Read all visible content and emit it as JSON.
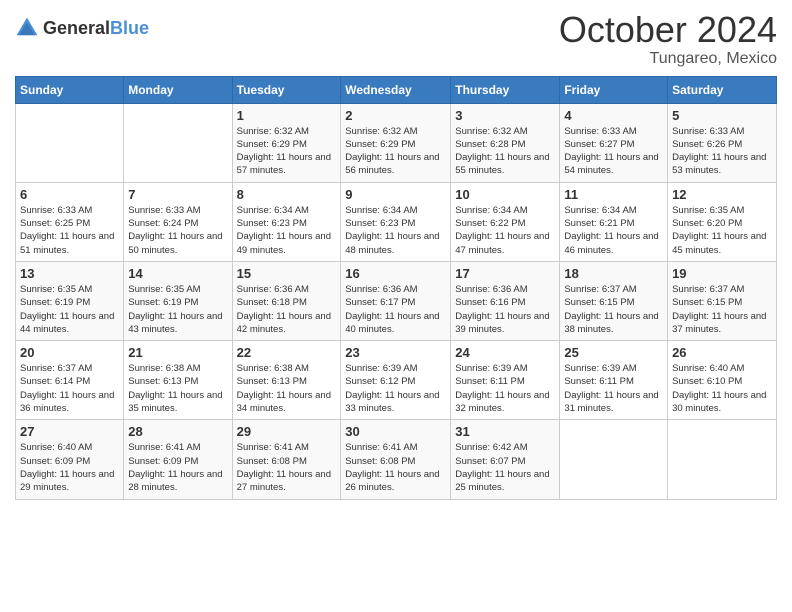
{
  "header": {
    "logo_general": "General",
    "logo_blue": "Blue",
    "month": "October 2024",
    "location": "Tungareo, Mexico"
  },
  "weekdays": [
    "Sunday",
    "Monday",
    "Tuesday",
    "Wednesday",
    "Thursday",
    "Friday",
    "Saturday"
  ],
  "weeks": [
    [
      {
        "day": "",
        "detail": ""
      },
      {
        "day": "",
        "detail": ""
      },
      {
        "day": "1",
        "detail": "Sunrise: 6:32 AM\nSunset: 6:29 PM\nDaylight: 11 hours and 57 minutes."
      },
      {
        "day": "2",
        "detail": "Sunrise: 6:32 AM\nSunset: 6:29 PM\nDaylight: 11 hours and 56 minutes."
      },
      {
        "day": "3",
        "detail": "Sunrise: 6:32 AM\nSunset: 6:28 PM\nDaylight: 11 hours and 55 minutes."
      },
      {
        "day": "4",
        "detail": "Sunrise: 6:33 AM\nSunset: 6:27 PM\nDaylight: 11 hours and 54 minutes."
      },
      {
        "day": "5",
        "detail": "Sunrise: 6:33 AM\nSunset: 6:26 PM\nDaylight: 11 hours and 53 minutes."
      }
    ],
    [
      {
        "day": "6",
        "detail": "Sunrise: 6:33 AM\nSunset: 6:25 PM\nDaylight: 11 hours and 51 minutes."
      },
      {
        "day": "7",
        "detail": "Sunrise: 6:33 AM\nSunset: 6:24 PM\nDaylight: 11 hours and 50 minutes."
      },
      {
        "day": "8",
        "detail": "Sunrise: 6:34 AM\nSunset: 6:23 PM\nDaylight: 11 hours and 49 minutes."
      },
      {
        "day": "9",
        "detail": "Sunrise: 6:34 AM\nSunset: 6:23 PM\nDaylight: 11 hours and 48 minutes."
      },
      {
        "day": "10",
        "detail": "Sunrise: 6:34 AM\nSunset: 6:22 PM\nDaylight: 11 hours and 47 minutes."
      },
      {
        "day": "11",
        "detail": "Sunrise: 6:34 AM\nSunset: 6:21 PM\nDaylight: 11 hours and 46 minutes."
      },
      {
        "day": "12",
        "detail": "Sunrise: 6:35 AM\nSunset: 6:20 PM\nDaylight: 11 hours and 45 minutes."
      }
    ],
    [
      {
        "day": "13",
        "detail": "Sunrise: 6:35 AM\nSunset: 6:19 PM\nDaylight: 11 hours and 44 minutes."
      },
      {
        "day": "14",
        "detail": "Sunrise: 6:35 AM\nSunset: 6:19 PM\nDaylight: 11 hours and 43 minutes."
      },
      {
        "day": "15",
        "detail": "Sunrise: 6:36 AM\nSunset: 6:18 PM\nDaylight: 11 hours and 42 minutes."
      },
      {
        "day": "16",
        "detail": "Sunrise: 6:36 AM\nSunset: 6:17 PM\nDaylight: 11 hours and 40 minutes."
      },
      {
        "day": "17",
        "detail": "Sunrise: 6:36 AM\nSunset: 6:16 PM\nDaylight: 11 hours and 39 minutes."
      },
      {
        "day": "18",
        "detail": "Sunrise: 6:37 AM\nSunset: 6:15 PM\nDaylight: 11 hours and 38 minutes."
      },
      {
        "day": "19",
        "detail": "Sunrise: 6:37 AM\nSunset: 6:15 PM\nDaylight: 11 hours and 37 minutes."
      }
    ],
    [
      {
        "day": "20",
        "detail": "Sunrise: 6:37 AM\nSunset: 6:14 PM\nDaylight: 11 hours and 36 minutes."
      },
      {
        "day": "21",
        "detail": "Sunrise: 6:38 AM\nSunset: 6:13 PM\nDaylight: 11 hours and 35 minutes."
      },
      {
        "day": "22",
        "detail": "Sunrise: 6:38 AM\nSunset: 6:13 PM\nDaylight: 11 hours and 34 minutes."
      },
      {
        "day": "23",
        "detail": "Sunrise: 6:39 AM\nSunset: 6:12 PM\nDaylight: 11 hours and 33 minutes."
      },
      {
        "day": "24",
        "detail": "Sunrise: 6:39 AM\nSunset: 6:11 PM\nDaylight: 11 hours and 32 minutes."
      },
      {
        "day": "25",
        "detail": "Sunrise: 6:39 AM\nSunset: 6:11 PM\nDaylight: 11 hours and 31 minutes."
      },
      {
        "day": "26",
        "detail": "Sunrise: 6:40 AM\nSunset: 6:10 PM\nDaylight: 11 hours and 30 minutes."
      }
    ],
    [
      {
        "day": "27",
        "detail": "Sunrise: 6:40 AM\nSunset: 6:09 PM\nDaylight: 11 hours and 29 minutes."
      },
      {
        "day": "28",
        "detail": "Sunrise: 6:41 AM\nSunset: 6:09 PM\nDaylight: 11 hours and 28 minutes."
      },
      {
        "day": "29",
        "detail": "Sunrise: 6:41 AM\nSunset: 6:08 PM\nDaylight: 11 hours and 27 minutes."
      },
      {
        "day": "30",
        "detail": "Sunrise: 6:41 AM\nSunset: 6:08 PM\nDaylight: 11 hours and 26 minutes."
      },
      {
        "day": "31",
        "detail": "Sunrise: 6:42 AM\nSunset: 6:07 PM\nDaylight: 11 hours and 25 minutes."
      },
      {
        "day": "",
        "detail": ""
      },
      {
        "day": "",
        "detail": ""
      }
    ]
  ]
}
